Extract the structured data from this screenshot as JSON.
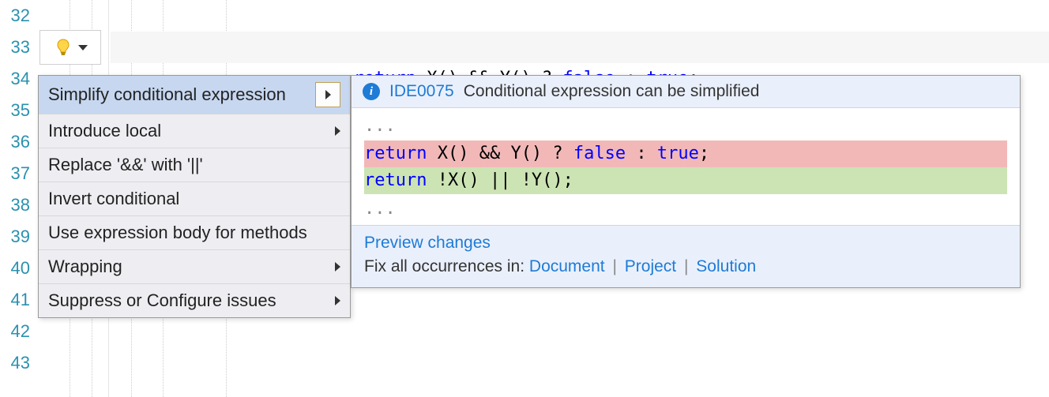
{
  "gutter": {
    "start": 32,
    "end": 43
  },
  "code": {
    "line33_keyword": "return",
    "line33_rest": " X() && Y() ? ",
    "line33_false": "false",
    "line33_mid": " : ",
    "line33_true": "true",
    "line33_end": ";"
  },
  "lightbulb": {
    "icon": "lightbulb"
  },
  "menu": {
    "items": [
      {
        "label": "Simplify conditional expression",
        "selected": true,
        "submenu": true
      },
      {
        "label": "Introduce local",
        "submenu": true
      },
      {
        "label": "Replace '&&' with '||'"
      },
      {
        "label": "Invert conditional"
      },
      {
        "label": "Use expression body for methods"
      },
      {
        "label": "Wrapping",
        "submenu": true
      },
      {
        "label": "Suppress or Configure issues",
        "submenu": true
      }
    ]
  },
  "preview": {
    "rule_id": "IDE0075",
    "rule_desc": "Conditional expression can be simplified",
    "ellipsis": "...",
    "del_kw": "return",
    "del_rest": " X() && Y() ? ",
    "del_false": "false",
    "del_mid": " : ",
    "del_true": "true",
    "del_end": ";",
    "add_kw": "return",
    "add_rest": " !X() || !Y();",
    "footer_preview_label": "Preview changes",
    "footer_fix_label": "Fix all occurrences in: ",
    "footer_links": [
      "Document",
      "Project",
      "Solution"
    ]
  }
}
